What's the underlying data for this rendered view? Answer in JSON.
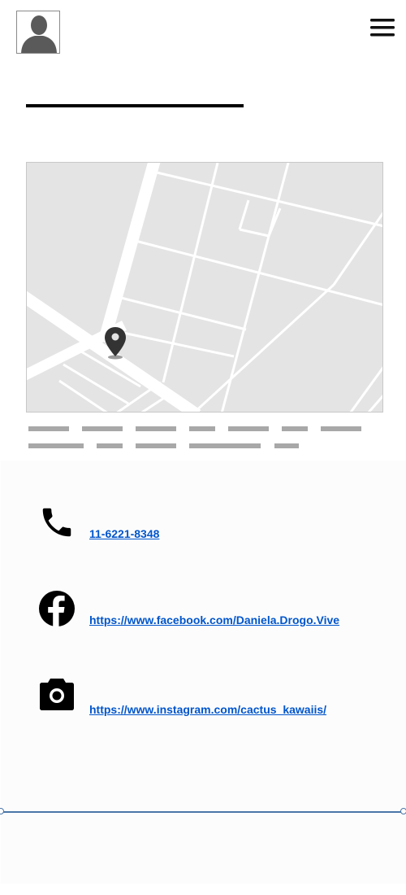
{
  "header": {
    "avatar_icon": "user-silhouette-icon",
    "menu_icon": "hamburger-menu-icon"
  },
  "map": {
    "pin_icon": "map-pin-icon"
  },
  "contacts": [
    {
      "icon": "phone-icon",
      "text": "11-6221-8348"
    },
    {
      "icon": "facebook-icon",
      "text": "https://www.facebook.com/Daniela.Drogo.Vive"
    },
    {
      "icon": "camera-icon",
      "text": "https://www.instagram.com/cactus_kawaiis/"
    }
  ],
  "colors": {
    "link": "#0055cc",
    "divider": "#4a76a8",
    "map_background": "#e4e4e4"
  }
}
